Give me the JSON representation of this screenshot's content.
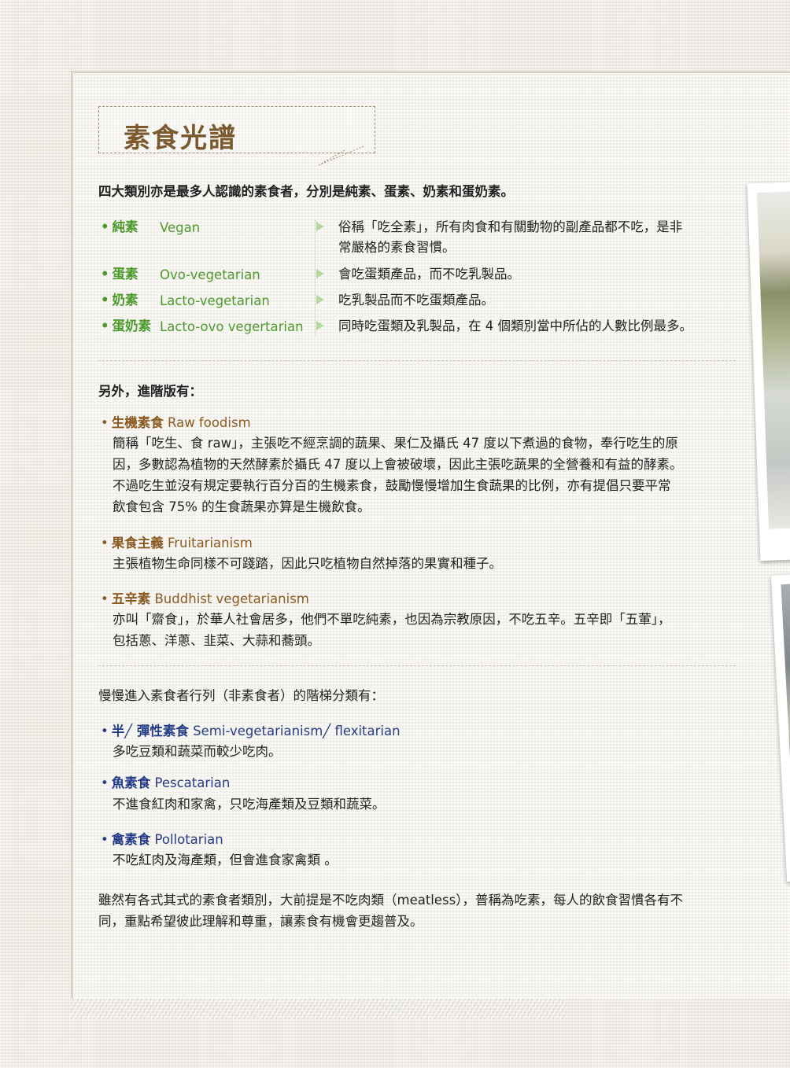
{
  "title": "素食光譜",
  "intro": "四大類別亦是最多人認識的素食者，分別是純素、蛋素、奶素和蛋奶素。",
  "categories": [
    {
      "zh": "純素",
      "en": "Vegan",
      "desc_line1": "俗稱「吃全素」，所有肉食和有關動物的副產品都不吃，是非",
      "desc_line2": "常嚴格的素食習慣。"
    },
    {
      "zh": "蛋素",
      "en": "Ovo-vegetarian",
      "desc_line1": "會吃蛋類產品，而不吃乳製品。"
    },
    {
      "zh": "奶素",
      "en": "Lacto-vegetarian",
      "desc_line1": "吃乳製品而不吃蛋類產品。"
    },
    {
      "zh": "蛋奶素",
      "en": "Lacto-ovo vegertarian",
      "desc_line1": "同時吃蛋類及乳製品，在 4 個類別當中所佔的人數比例最多。"
    }
  ],
  "advanced": {
    "heading": "另外，進階版有：",
    "items": [
      {
        "zh": "生機素食",
        "en": "Raw foodism",
        "lines": [
          "簡稱「吃生、食 raw」，主張吃不經烹調的蔬果、果仁及攝氏 47 度以下煮過的食物，奉行吃生的原",
          "因，多數認為植物的天然酵素於攝氏 47 度以上會被破壞，因此主張吃蔬果的全營養和有益的酵素。",
          "不過吃生並沒有規定要執行百分百的生機素食，鼓勵慢慢增加生食蔬果的比例，亦有提倡只要平常",
          "飲食包含 75% 的生食蔬果亦算是生機飲食。"
        ]
      },
      {
        "zh": "果食主義",
        "en": "Fruitarianism",
        "lines": [
          "主張植物生命同樣不可踐踏，因此只吃植物自然掉落的果實和種子。"
        ]
      },
      {
        "zh": "五辛素",
        "en": "Buddhist vegetarianism",
        "lines": [
          "亦叫「齋食」，於華人社會居多，他們不單吃純素，也因為宗教原因，不吃五辛。五辛即「五葷」，",
          "包括蔥、洋蔥、韭菜、大蒜和蕎頭。"
        ]
      }
    ]
  },
  "gradual": {
    "heading": "慢慢進入素食者行列（非素食者）的階梯分類有：",
    "items": [
      {
        "zh": "半╱ 彈性素食",
        "en": "Semi-vegetarianism╱  flexitarian",
        "line": "多吃豆類和蔬菜而較少吃肉。"
      },
      {
        "zh": "魚素食",
        "en": "Pescatarian",
        "line": "不進食紅肉和家禽，只吃海產類及豆類和蔬菜。"
      },
      {
        "zh": "禽素食",
        "en": "Pollotarian",
        "line": "不吃紅肉及海產類，但會進食家禽類 。"
      }
    ]
  },
  "conclusion": [
    "雖然有各式其式的素食者類別，大前提是不吃肉類（meatless），普稱為吃素，每人的飲食習慣各有不",
    "同，重點希望彼此理解和尊重，讓素食有機會更趨普及。"
  ],
  "colors": {
    "green": "#4d9a2c",
    "brown": "#8a5a22",
    "blue": "#243b86",
    "title": "#7a5a2e"
  }
}
